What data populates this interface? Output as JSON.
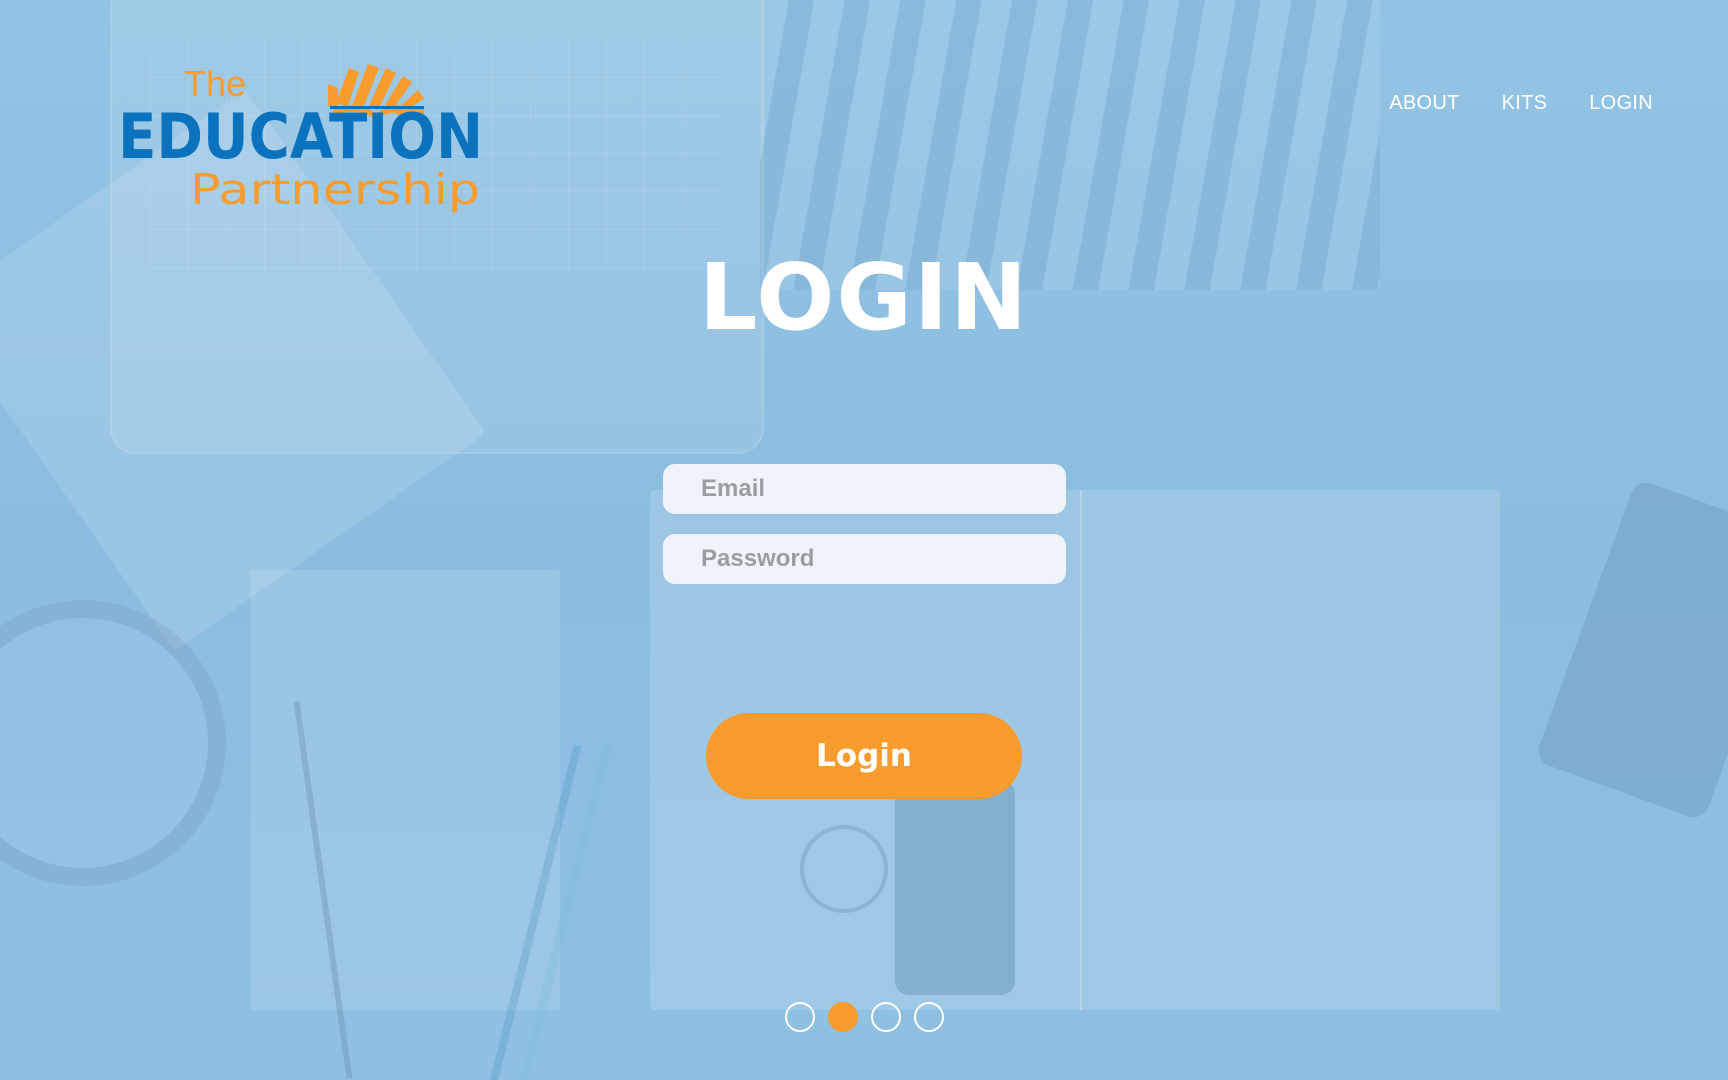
{
  "brand": {
    "logo_line1": "The",
    "logo_line2": "EDUCATION",
    "logo_line3": "Partnership",
    "colors": {
      "blue": "#0b72bd",
      "orange": "#f89c2e"
    }
  },
  "nav": {
    "items": [
      {
        "label": "ABOUT"
      },
      {
        "label": "KITS"
      },
      {
        "label": "LOGIN"
      }
    ]
  },
  "main": {
    "title": "LOGIN",
    "email_placeholder": "Email",
    "password_placeholder": "Password",
    "submit_label": "Login"
  },
  "carousel": {
    "total": 4,
    "active_index": 1
  },
  "colors": {
    "accent": "#f89c2e",
    "background_tint": "#8fbfe0",
    "input_bg": "#eef4fa",
    "text_on_bg": "#ffffff"
  }
}
